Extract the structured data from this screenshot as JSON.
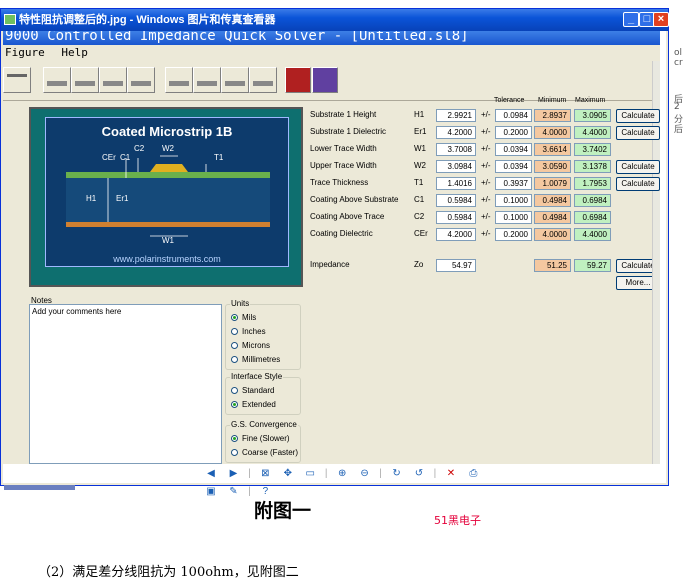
{
  "viewer": {
    "title": "特性阻抗调整后的.jpg - Windows 图片和传真查看器",
    "min": "_",
    "max": "□",
    "close": "×"
  },
  "inner": {
    "title": "9000 Controlled Impedance Quick Solver - [Untitled.sl8]",
    "menu": [
      "Figure",
      "Help"
    ]
  },
  "graphic": {
    "title": "Coated Microstrip 1B",
    "url": "www.polarinstruments.com",
    "labels": {
      "cer": "CEr",
      "c1": "C1",
      "c2": "C2",
      "w2": "W2",
      "t1": "T1",
      "h1": "H1",
      "er1": "Er1",
      "w1": "W1"
    }
  },
  "headers": {
    "tolerance": "Tolerance",
    "minimum": "Minimum",
    "maximum": "Maximum"
  },
  "params": [
    {
      "label": "Substrate 1 Height",
      "sym": "H1",
      "value": "2.9921",
      "tol": "0.0984",
      "min": "2.8937",
      "max": "3.0905",
      "calc": "Calculate"
    },
    {
      "label": "Substrate 1 Dielectric",
      "sym": "Er1",
      "value": "4.2000",
      "tol": "0.2000",
      "min": "4.0000",
      "max": "4.4000",
      "calc": "Calculate"
    },
    {
      "label": "Lower Trace Width",
      "sym": "W1",
      "value": "3.7008",
      "tol": "0.0394",
      "min": "3.6614",
      "max": "3.7402",
      "calc": ""
    },
    {
      "label": "Upper Trace Width",
      "sym": "W2",
      "value": "3.0984",
      "tol": "0.0394",
      "min": "3.0590",
      "max": "3.1378",
      "calc": "Calculate"
    },
    {
      "label": "Trace Thickness",
      "sym": "T1",
      "value": "1.4016",
      "tol": "0.3937",
      "min": "1.0079",
      "max": "1.7953",
      "calc": "Calculate"
    },
    {
      "label": "Coating Above Substrate",
      "sym": "C1",
      "value": "0.5984",
      "tol": "0.1000",
      "min": "0.4984",
      "max": "0.6984",
      "calc": ""
    },
    {
      "label": "Coating Above Trace",
      "sym": "C2",
      "value": "0.5984",
      "tol": "0.1000",
      "min": "0.4984",
      "max": "0.6984",
      "calc": ""
    },
    {
      "label": "Coating Dielectric",
      "sym": "CEr",
      "value": "4.2000",
      "tol": "0.2000",
      "min": "4.0000",
      "max": "4.4000",
      "calc": ""
    }
  ],
  "pm": "+/-",
  "impedance": {
    "label": "Impedance",
    "sym": "Zo",
    "value": "54.97",
    "min": "51.25",
    "max": "59.27",
    "calc": "Calculate",
    "more": "More..."
  },
  "notes": {
    "label": "Notes",
    "text": "Add your comments here"
  },
  "units": {
    "title": "Units",
    "options": [
      "Mils",
      "Inches",
      "Microns",
      "Millimetres"
    ],
    "selected": 0
  },
  "interface": {
    "title": "Interface Style",
    "options": [
      "Standard",
      "Extended"
    ],
    "selected": 1
  },
  "convergence": {
    "title": "G.S. Convergence",
    "options": [
      "Fine (Slower)",
      "Coarse (Faster)"
    ],
    "selected": 0
  },
  "caption": "附图一",
  "watermark": "51黑电子",
  "paragraph": "（2）满足差分线阻抗为 100ohm，见附图二",
  "side_text": [
    "ol",
    "cr",
    "后",
    "2",
    "分",
    "后"
  ]
}
